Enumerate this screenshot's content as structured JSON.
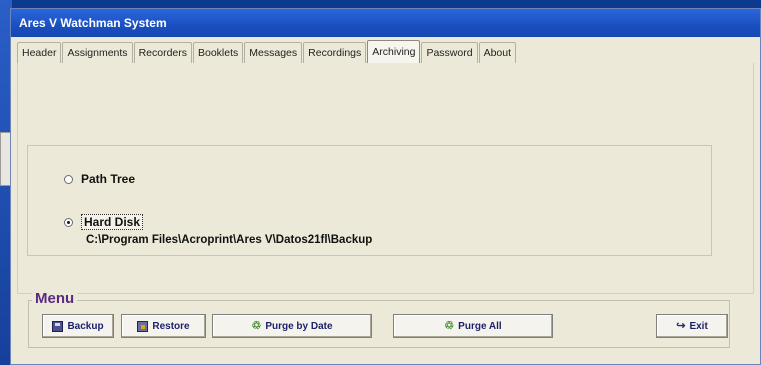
{
  "window": {
    "title": "Ares V Watchman System"
  },
  "tabs": [
    {
      "label": "Header",
      "active": false
    },
    {
      "label": "Assignments",
      "active": false
    },
    {
      "label": "Recorders",
      "active": false
    },
    {
      "label": "Booklets",
      "active": false
    },
    {
      "label": "Messages",
      "active": false
    },
    {
      "label": "Recordings",
      "active": false
    },
    {
      "label": "Archiving",
      "active": true
    },
    {
      "label": "Password",
      "active": false
    },
    {
      "label": "About",
      "active": false
    }
  ],
  "archiving": {
    "options": [
      {
        "label": "Path Tree",
        "checked": false
      },
      {
        "label": "Hard Disk",
        "checked": true
      }
    ],
    "path": "C:\\Program Files\\Acroprint\\Ares V\\Datos21fl\\Backup"
  },
  "menu": {
    "legend": "Menu",
    "buttons": {
      "backup": "Backup",
      "restore": "Restore",
      "purge_by_date": "Purge by Date",
      "purge_all": "Purge All",
      "exit": "Exit"
    }
  },
  "icons": {
    "backup": "disk-icon",
    "restore": "restore-icon",
    "purge": "trash-icon",
    "exit": "exit-icon"
  },
  "colors": {
    "title_bar": "#1a4fbf",
    "window_bg": "#ece9d8",
    "menu_legend": "#5a2a82",
    "button_text": "#1c1f6b"
  }
}
